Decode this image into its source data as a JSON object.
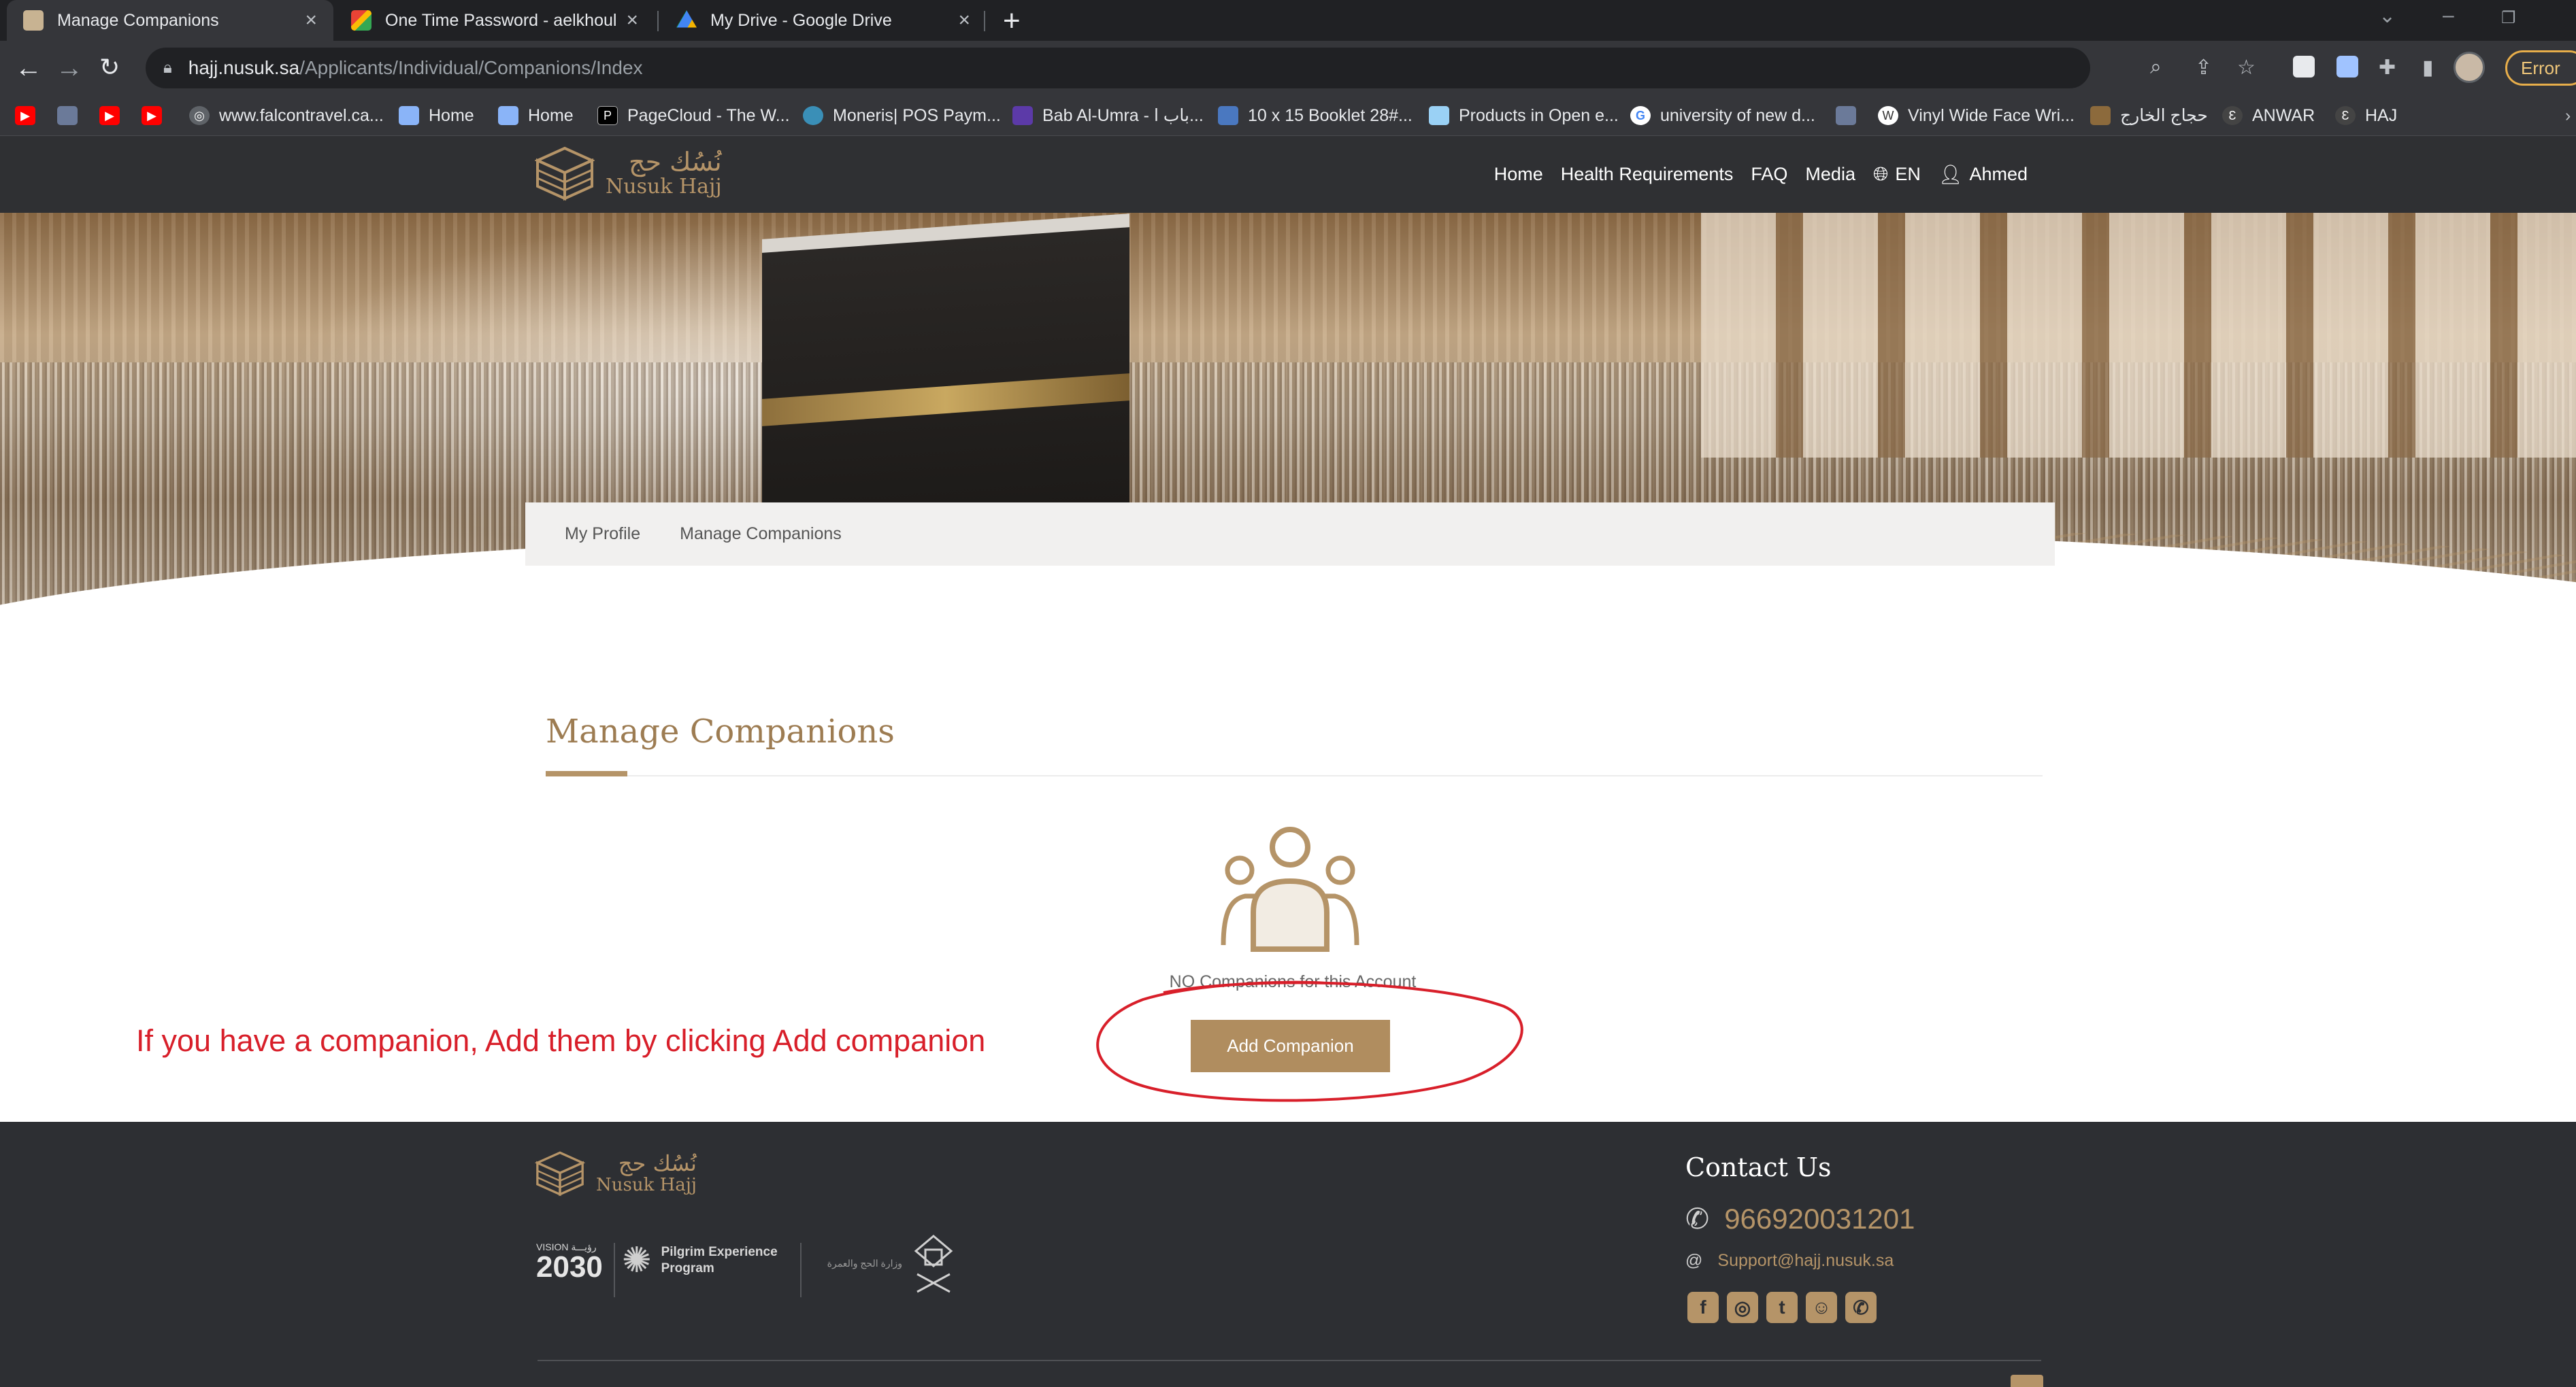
{
  "browser": {
    "tabs": [
      {
        "title": "Manage Companions",
        "active": true,
        "icon": "nusuk-icon"
      },
      {
        "title": "One Time Password - aelkhouly@",
        "active": false,
        "icon": "gmail-icon"
      },
      {
        "title": "My Drive - Google Drive",
        "active": false,
        "icon": "drive-icon"
      }
    ],
    "url_host": "hajj.nusuk.sa",
    "url_path": "/Applicants/Individual/Companions/Index",
    "profile_status": "Error",
    "bookmarks": [
      "www.falcontravel.ca...",
      "Home",
      "Home",
      "PageCloud - The W...",
      "Moneris| POS Paym...",
      "Bab Al-Umra - باب ا...",
      "10 x 15 Booklet 28#...",
      "Products in Open e...",
      "university of new d...",
      "Vinyl Wide Face Wri...",
      "حجاج الخارج",
      "ANWAR",
      "HAJ"
    ]
  },
  "site": {
    "logo_ar": "نُسُك حج",
    "logo_en": "Nusuk Hajj",
    "nav": [
      "Home",
      "Health Requirements",
      "FAQ",
      "Media"
    ],
    "language": "EN",
    "user_name": "Ahmed"
  },
  "breadcrumb": [
    "My Profile",
    "Manage Companions"
  ],
  "main": {
    "title": "Manage Companions",
    "empty_message": "NO Companions for this Account",
    "add_button": "Add Companion"
  },
  "annotation": {
    "text": "If you have a companion, Add them by clicking Add companion",
    "color": "#d81f2a"
  },
  "footer": {
    "logo_ar": "نُسُك حج",
    "logo_en": "Nusuk Hajj",
    "vision_text": "VISION رؤيـــة",
    "vision_year": "2030",
    "program_line1": "Pilgrim Experience",
    "program_line2": "Program",
    "ministry_ar": "وزارة الحج والعمرة",
    "contact_title": "Contact Us",
    "phone": "966920031201",
    "email": "Support@hajj.nusuk.sa"
  },
  "colors": {
    "brand_gold": "#b59468",
    "header_dark": "#2f3033",
    "footer_dark": "#2d2f33"
  }
}
